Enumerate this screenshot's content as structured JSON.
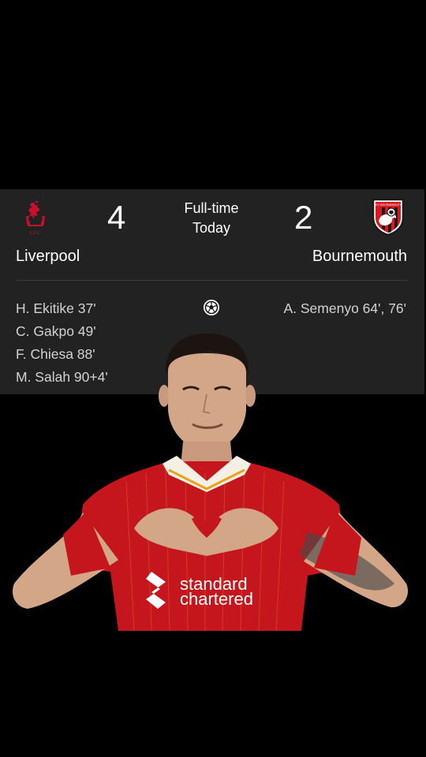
{
  "match": {
    "status": "Full-time",
    "date": "Today",
    "home": {
      "name": "Liverpool",
      "score": "4",
      "crest": "liverpool-crest-icon",
      "crest_text": "L.F.C.",
      "scorers": [
        "H. Ekitike 37'",
        "C. Gakpo 49'",
        "F. Chiesa 88'",
        "M. Salah 90+4'"
      ]
    },
    "away": {
      "name": "Bournemouth",
      "score": "2",
      "crest": "bournemouth-crest-icon",
      "crest_text": "AFC BOURNEMOUTH",
      "scorers": [
        "A. Semenyo 64', 76'"
      ]
    },
    "goal_icon": "soccer-ball-icon"
  },
  "photo": {
    "sponsor_line1": "standard",
    "sponsor_line2": "chartered"
  },
  "colors": {
    "card_bg": "#222222",
    "page_bg": "#000000",
    "text_primary": "#ffffff",
    "text_secondary": "#d2d2d2",
    "liverpool_red": "#c8102e",
    "shirt_red": "#c4161c"
  }
}
